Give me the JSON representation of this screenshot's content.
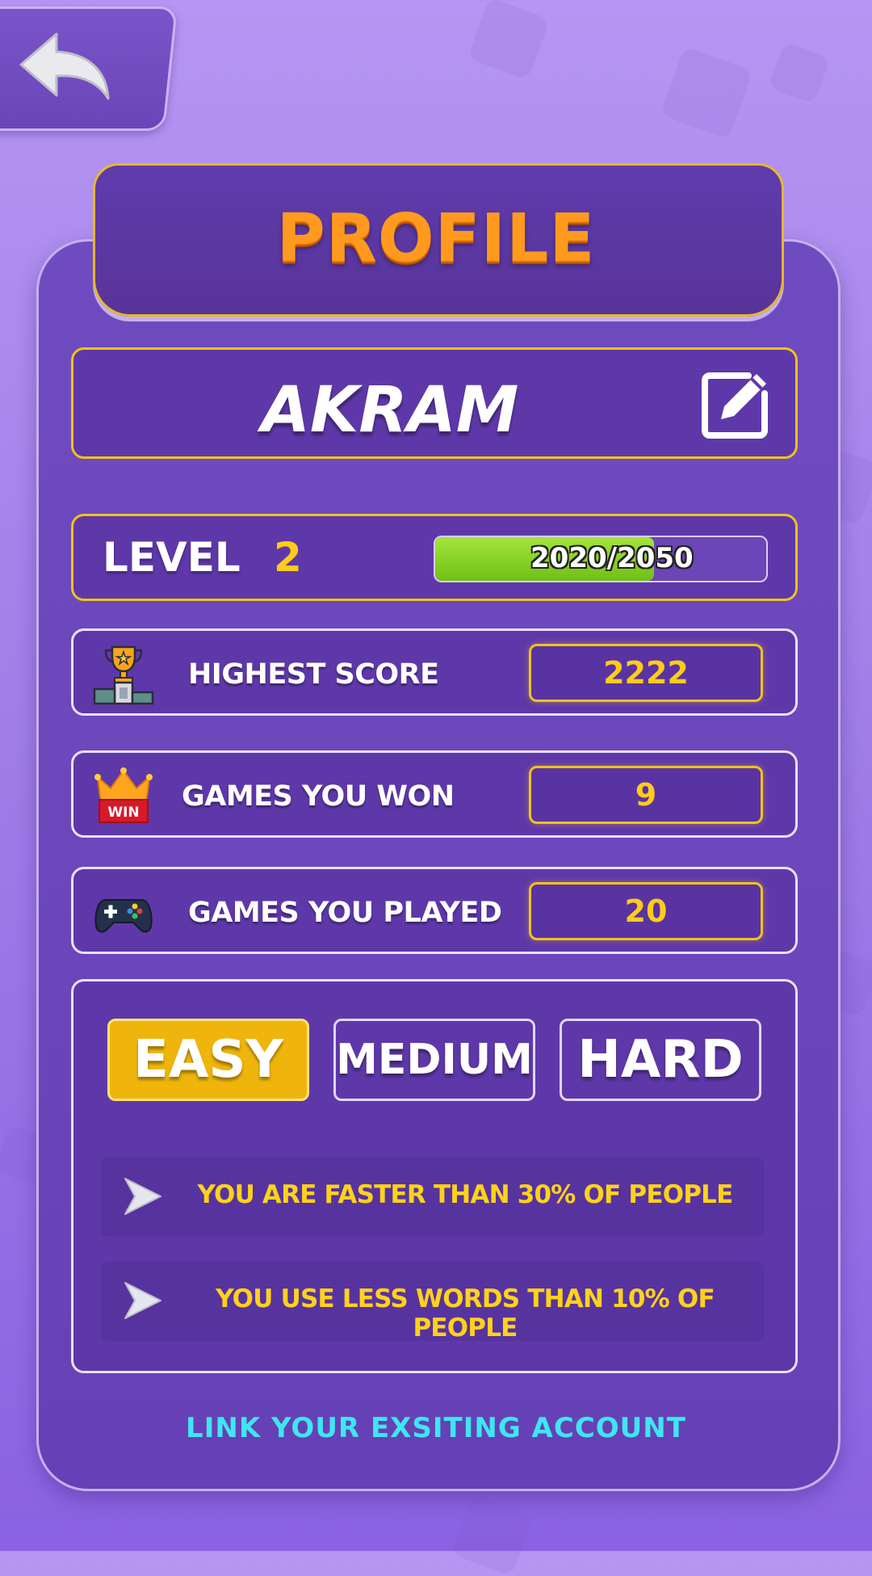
{
  "colors": {
    "background": "#a688ec",
    "panel": "#6a46ba",
    "gold_border": "#f0c21d",
    "title_orange": "#ff9a1e",
    "value_yellow": "#ffcc1a",
    "progress_green": "#7cc91c",
    "easy_active": "#f0b50c",
    "link_cyan": "#3fe6f0"
  },
  "header": {
    "back_icon": "back-arrow-icon",
    "title": "PROFILE"
  },
  "profile": {
    "name": "AKRAM",
    "edit_icon": "edit-pencil-icon"
  },
  "level": {
    "label": "LEVEL",
    "value": "2",
    "progress_text": "2020/2050",
    "progress_fraction": 0.66
  },
  "stats": [
    {
      "icon": "trophy-podium-icon",
      "label": "HIGHEST SCORE",
      "value": "2222"
    },
    {
      "icon": "win-crown-icon",
      "label": "GAMES YOU WON",
      "value": "9"
    },
    {
      "icon": "gamepad-icon",
      "label": "GAMES YOU PLAYED",
      "value": "20"
    }
  ],
  "difficulty": {
    "options": [
      "EASY",
      "MEDIUM",
      "HARD"
    ],
    "selected": "EASY",
    "insights": [
      {
        "icon": "arrow-right-icon",
        "text": "YOU ARE FASTER THAN 30%  OF PEOPLE"
      },
      {
        "icon": "arrow-right-icon",
        "text": "YOU USE LESS WORDS THAN 10% OF PEOPLE"
      }
    ]
  },
  "footer": {
    "link_label": "LINK YOUR EXSITING ACCOUNT"
  }
}
